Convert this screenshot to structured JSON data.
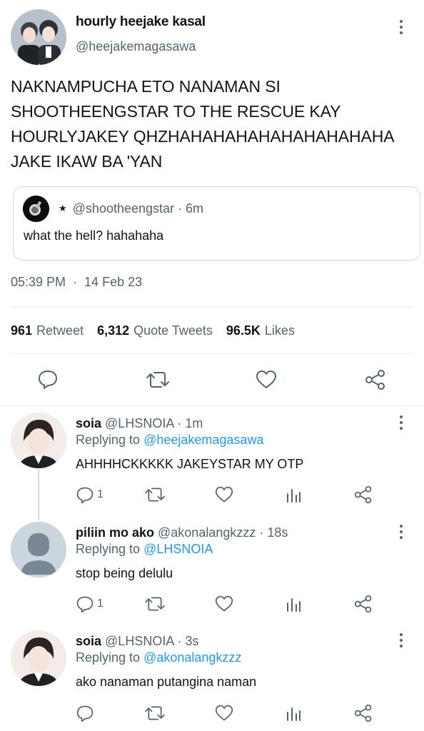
{
  "tweet": {
    "author_name": "hourly heejake kasal",
    "author_handle": "@heejakemagasawa",
    "text": "NAKNAMPUCHA ETO NANAMAN SI\nSHOOTHEENGSTAR TO THE RESCUE KAY\nHOURLYJAKEY QHZHAHAHAHAHAHAHAHAHAHA\nJAKE IKAW BA 'YAN",
    "quote": {
      "handle": "@shootheengstar",
      "time": "· 6m",
      "text": "what the hell? hahahaha"
    },
    "time": "05:39 PM",
    "date": "14 Feb 23",
    "stats": {
      "retweets": "961",
      "retweets_label": "Retweet",
      "quotes": "6,312",
      "quotes_label": "Quote Tweets",
      "likes": "96.5K",
      "likes_label": "Likes"
    }
  },
  "replies": [
    {
      "name": "soia",
      "handle": "@LHSNOIA",
      "time": "· 1m",
      "replying_prefix": "Replying to",
      "replying_to": "@heejakemagasawa",
      "text": "AHHHHCKKKKK JAKEYSTAR MY OTP",
      "reply_count": "1"
    },
    {
      "name": "piliin mo ako",
      "handle": "@akonalangkzzz",
      "time": "· 18s",
      "replying_prefix": "Replying to",
      "replying_to": "@LHSNOIA",
      "text": "stop being delulu",
      "reply_count": "1"
    },
    {
      "name": "soia",
      "handle": "@LHSNOIA",
      "time": "· 3s",
      "replying_prefix": "Replying to",
      "replying_to": "@akonalangkzzz",
      "text": "ako nanaman putangina naman",
      "reply_count": ""
    }
  ],
  "icons": {
    "reply": "comment-icon",
    "retweet": "retweet-icon",
    "like": "heart-icon",
    "share": "share-icon",
    "views": "analytics-icon",
    "more": "more-vertical-icon"
  },
  "colors": {
    "link": "#1d9bf0",
    "secondary_text": "#536471",
    "primary_text": "#0f1419",
    "border": "#cfd9de"
  }
}
